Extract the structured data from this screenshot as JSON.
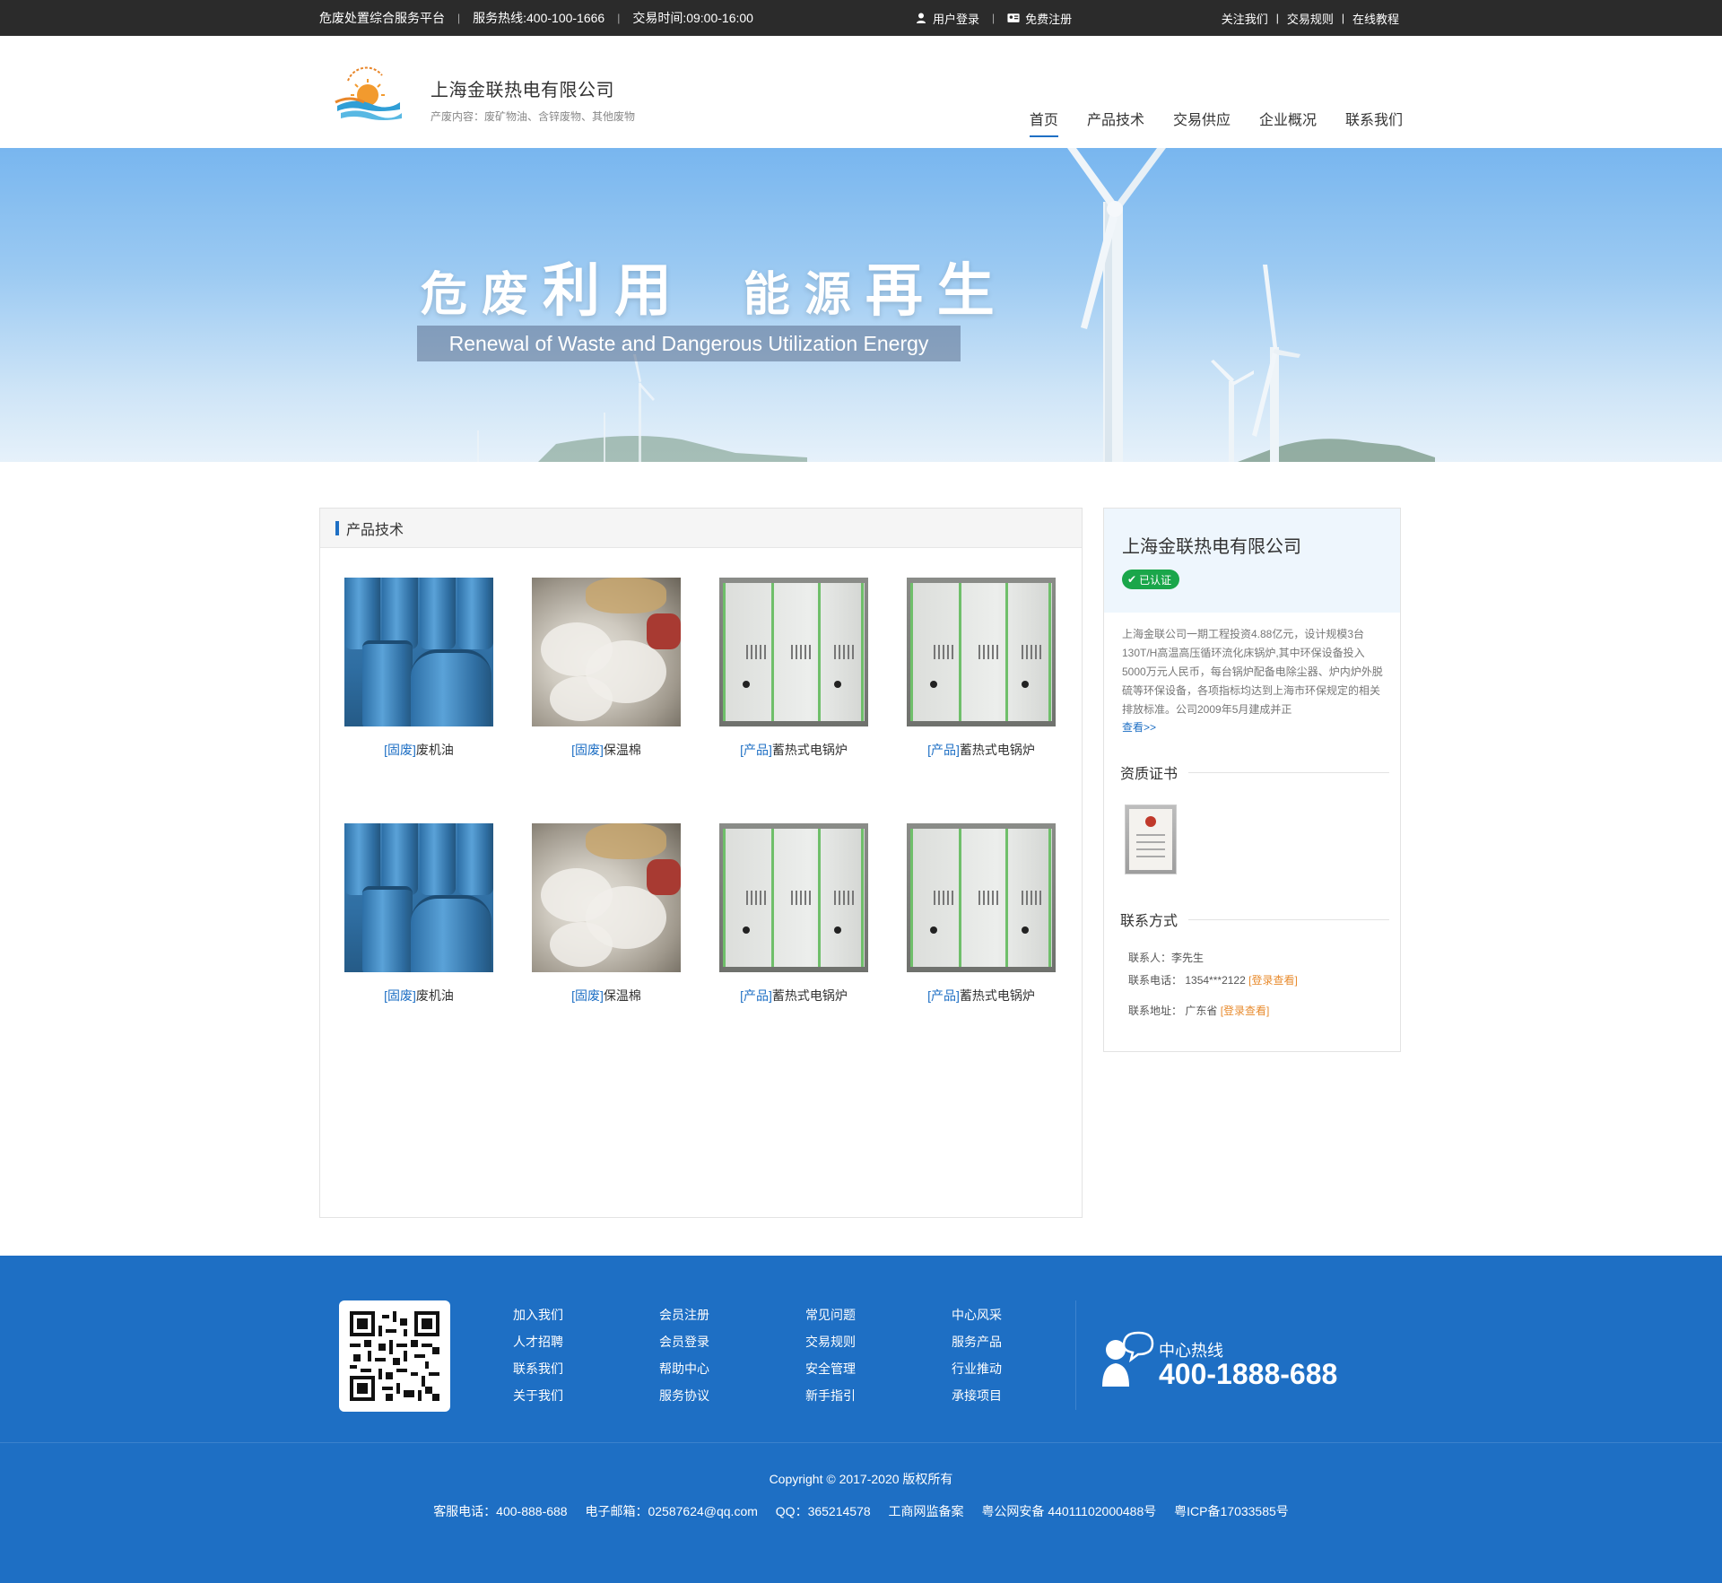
{
  "topbar": {
    "platform": "危废处置综合服务平台",
    "hotline": "服务热线:400-100-1666",
    "hours": "交易时间:09:00-16:00",
    "login": "用户登录",
    "register": "免费注册",
    "follow": "关注我们",
    "rules": "交易规则",
    "tutorial": "在线教程",
    "sep": "|"
  },
  "header": {
    "company": "上海金联热电有限公司",
    "subtitle": "产废内容：废矿物油、含锌废物、其他废物",
    "logo_icon": "sun-sand-logo",
    "nav": [
      {
        "label": "首页",
        "active": true
      },
      {
        "label": "产品技术"
      },
      {
        "label": "交易供应"
      },
      {
        "label": "企业概况"
      },
      {
        "label": "联系我们"
      }
    ]
  },
  "banner": {
    "title_a": "危废",
    "title_b": "利用",
    "title_c": "能源",
    "title_d": "再生",
    "subtitle": "Renewal of Waste and Dangerous Utilization Energy"
  },
  "products": {
    "title": "产品技术",
    "items": [
      {
        "tag": "[固废]",
        "name": "废机油"
      },
      {
        "tag": "[固废]",
        "name": "保温棉"
      },
      {
        "tag": "[产品]",
        "name": "蓄热式电锅炉"
      },
      {
        "tag": "[产品]",
        "name": "蓄热式电锅炉"
      },
      {
        "tag": "[固废]",
        "name": "废机油"
      },
      {
        "tag": "[固废]",
        "name": "保温棉"
      },
      {
        "tag": "[产品]",
        "name": "蓄热式电锅炉"
      },
      {
        "tag": "[产品]",
        "name": "蓄热式电锅炉"
      }
    ]
  },
  "sidebar": {
    "company": "上海金联热电有限公司",
    "verified": "已认证",
    "description": "上海金联公司一期工程投资4.88亿元，设计规模3台130T/H高温高压循环流化床锅炉,其中环保设备投入5000万元人民币，每台锅炉配备电除尘器、炉内炉外脱硫等环保设备，各项指标均达到上海市环保规定的相关排放标准。公司2009年5月建成并正",
    "more": "查看>>",
    "cert_title": "资质证书",
    "contact_title": "联系方式",
    "contact_person_label": "联系人：",
    "contact_person": "李先生",
    "phone_label": "联系电话：",
    "phone": "1354***2122",
    "address_label": "联系地址：",
    "address": "广东省",
    "login_view": "[登录查看]"
  },
  "footer": {
    "links": [
      "加入我们",
      "会员注册",
      "常见问题",
      "中心风采",
      "人才招聘",
      "会员登录",
      "交易规则",
      "服务产品",
      "联系我们",
      "帮助中心",
      "安全管理",
      "行业推动",
      "关于我们",
      "服务协议",
      "新手指引",
      "承接项目"
    ],
    "hotline_label": "中心热线",
    "hotline_number": "400-1888-688",
    "copyright": "Copyright © 2017-2020  版权所有",
    "service_phone": "客服电话：400-888-688",
    "email": "电子邮箱：02587624@qq.com",
    "qq": "QQ：365214578",
    "gongshang": "工商网监备案",
    "gongan": "粤公网安备 44011102000488号",
    "icp": "粤ICP备17033585号"
  },
  "colors": {
    "accent": "#1e6fc4",
    "topbar_bg": "#2b2b2b",
    "verified_green": "#1aa64a",
    "login_orange": "#e88b2e"
  }
}
